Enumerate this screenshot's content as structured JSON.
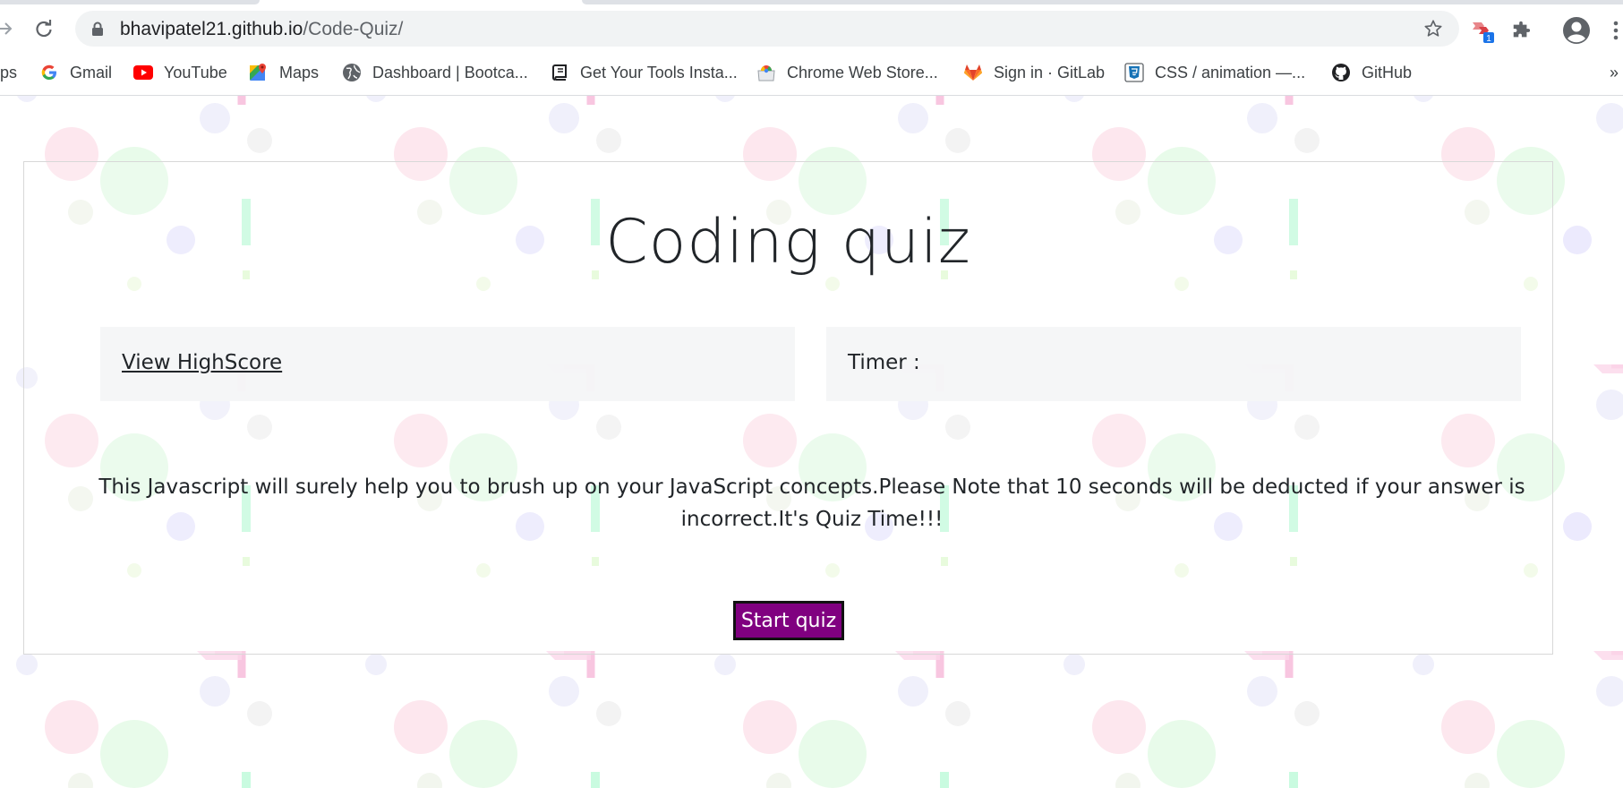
{
  "browser": {
    "url_host": "bhavipatel21.github.io",
    "url_path": "/Code-Quiz/",
    "extension_badge": "1",
    "bookmarks": [
      {
        "label": "ps",
        "icon": "apps-icon"
      },
      {
        "label": "Gmail",
        "icon": "google-icon"
      },
      {
        "label": "YouTube",
        "icon": "youtube-icon"
      },
      {
        "label": "Maps",
        "icon": "maps-icon"
      },
      {
        "label": "Dashboard | Bootca...",
        "icon": "globe-icon"
      },
      {
        "label": "Get Your Tools Insta...",
        "icon": "book-icon"
      },
      {
        "label": "Chrome Web Store...",
        "icon": "chrome-web-store-icon"
      },
      {
        "label": "Sign in · GitLab",
        "icon": "gitlab-icon"
      },
      {
        "label": "CSS / animation —...",
        "icon": "css3-icon"
      },
      {
        "label": "GitHub",
        "icon": "github-icon"
      }
    ],
    "overflow": "»"
  },
  "quiz": {
    "title": "Coding quiz",
    "highscore_link": "View HighScore",
    "timer_label": "Timer :",
    "timer_value": "",
    "intro": "This Javascript will surely help you to brush up on your JavaScript concepts.Please Note that 10 seconds will be deducted if your answer is incorrect.It's Quiz Time!!!",
    "start_button": "Start quiz"
  },
  "colors": {
    "start_button_bg": "#800080",
    "omnibox_bg": "#f1f3f4",
    "text": "#212529"
  }
}
